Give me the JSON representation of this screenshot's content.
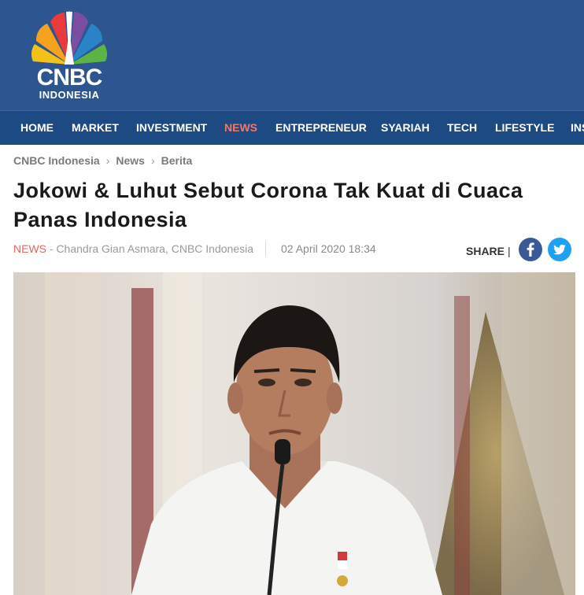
{
  "site": {
    "logo_main": "CNBC",
    "logo_sub": "INDONESIA"
  },
  "nav": {
    "items": [
      {
        "label": "HOME"
      },
      {
        "label": "MARKET"
      },
      {
        "label": "INVESTMENT"
      },
      {
        "label": "NEWS",
        "active": true
      },
      {
        "label": "ENTREPRENEUR"
      },
      {
        "label": "SYARIAH"
      },
      {
        "label": "TECH"
      },
      {
        "label": "LIFESTYLE"
      },
      {
        "label": "INS"
      }
    ]
  },
  "breadcrumb": [
    "CNBC Indonesia",
    "News",
    "Berita"
  ],
  "article": {
    "title": "Jokowi & Luhut Sebut Corona Tak Kuat di Cuaca Panas Indonesia",
    "category": "NEWS",
    "author_line": " - Chandra Gian Asmara, CNBC Indonesia",
    "date": "02 April 2020 18:34"
  },
  "share": {
    "label": "SHARE",
    "separator": "|",
    "networks": [
      {
        "name": "facebook",
        "icon": "facebook-icon",
        "color": "#3b5998"
      },
      {
        "name": "twitter",
        "icon": "twitter-icon",
        "color": "#1da1f2"
      }
    ]
  },
  "colors": {
    "header_bg": "#2d5691",
    "nav_bg": "#1e4a84",
    "nav_active": "#f0776a",
    "category": "#e0685e"
  }
}
